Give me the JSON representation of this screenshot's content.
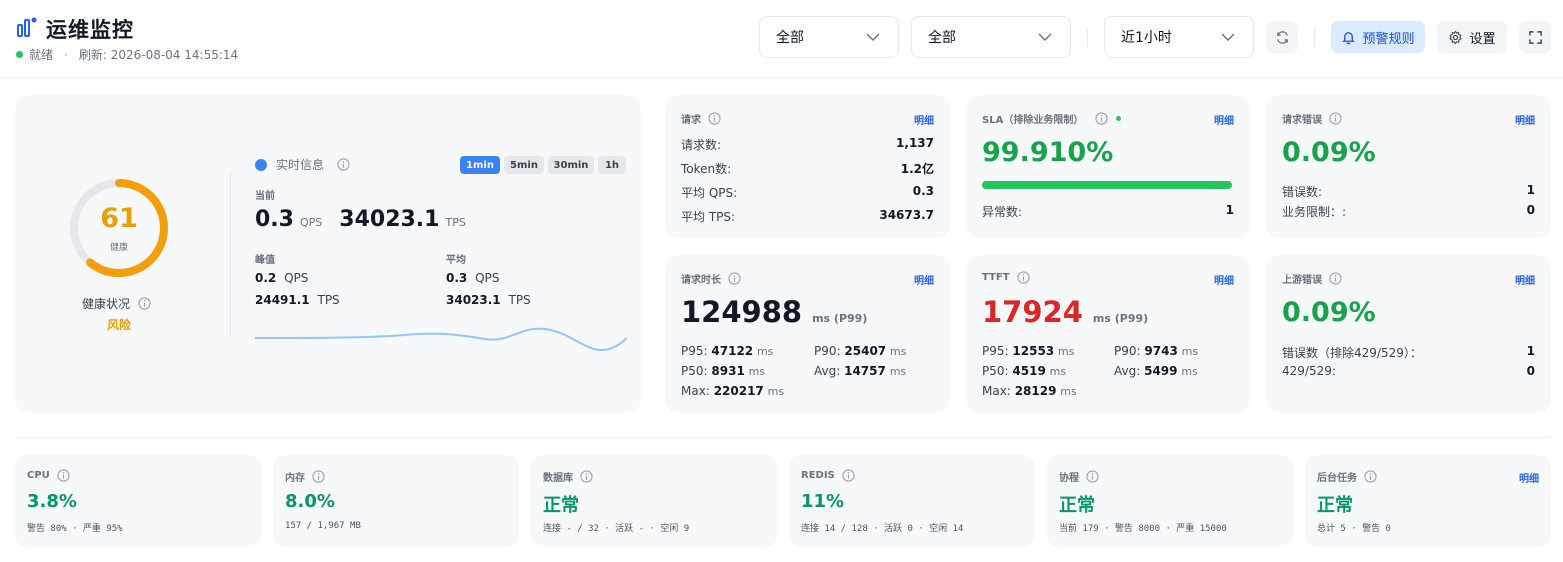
{
  "header": {
    "title": "运维监控",
    "status": "就绪",
    "sep": "·",
    "refresh": "刷新: 2026-08-04 14:55:14",
    "filter1": "全部",
    "filter2": "全部",
    "range": "近1小时",
    "alert_rules": "预警规则",
    "settings": "设置"
  },
  "colors": {
    "accent": "#3b82f6",
    "ok": "#16a34a",
    "danger": "#dc2626",
    "gauge": "#f59e0b"
  },
  "health": {
    "score": "61",
    "score_label": "健康",
    "title": "健康状况",
    "level": "风险",
    "score_fraction": 0.61
  },
  "realtime": {
    "title": "实时信息",
    "tabs": [
      "1min",
      "5min",
      "30min",
      "1h"
    ],
    "current_label": "当前",
    "current_qps": "0.3",
    "qps_unit": "QPS",
    "current_tps": "34023.1",
    "tps_unit": "TPS",
    "peak_label": "峰值",
    "peak_qps": "0.2",
    "peak_tps": "24491.1",
    "avg_label": "平均",
    "avg_qps": "0.3",
    "avg_tps": "34023.1"
  },
  "requests": {
    "label": "请求",
    "detail": "明细",
    "rows": [
      {
        "k": "请求数:",
        "v": "1,137"
      },
      {
        "k": "Token数:",
        "v": "1.2亿"
      },
      {
        "k": "平均 QPS:",
        "v": "0.3"
      },
      {
        "k": "平均 TPS:",
        "v": "34673.7"
      }
    ]
  },
  "sla": {
    "label": "SLA（排除业务限制）",
    "detail": "明细",
    "value": "99.910%",
    "progress": 0.9991,
    "abnormal_label": "异常数:",
    "abnormal": "1"
  },
  "req_errors": {
    "label": "请求错误",
    "detail": "明细",
    "value": "0.09%",
    "rows": [
      {
        "k": "错误数:",
        "v": "1"
      },
      {
        "k": "业务限制：:",
        "v": "0"
      }
    ]
  },
  "latency": {
    "label": "请求时长",
    "detail": "明细",
    "value": "124988",
    "unit": "ms (P99)",
    "p95_label": "P95:",
    "p95": "47122",
    "p90_label": "P90:",
    "p90": "25407",
    "p50_label": "P50:",
    "p50": "8931",
    "avg_label": "Avg:",
    "avg": "14757",
    "max_label": "Max:",
    "max": "220217",
    "ms": "ms"
  },
  "ttft": {
    "label": "TTFT",
    "detail": "明细",
    "value": "17924",
    "unit": "ms (P99)",
    "p95_label": "P95:",
    "p95": "12553",
    "p90_label": "P90:",
    "p90": "9743",
    "p50_label": "P50:",
    "p50": "4519",
    "avg_label": "Avg:",
    "avg": "5499",
    "max_label": "Max:",
    "max": "28129",
    "ms": "ms"
  },
  "upstream": {
    "label": "上游错误",
    "detail": "明细",
    "value": "0.09%",
    "rows": [
      {
        "k": "错误数（排除429/529）：",
        "v": "1"
      },
      {
        "k": "429/529:",
        "v": "0"
      }
    ]
  },
  "system": [
    {
      "label": "CPU",
      "value": "3.8%",
      "sub": "警告 80% · 严重 95%"
    },
    {
      "label": "内存",
      "value": "8.0%",
      "sub": "157 / 1,967 MB"
    },
    {
      "label": "数据库",
      "value": "正常",
      "sub": "连接 - / 32 · 活跃 - · 空闲 9"
    },
    {
      "label": "REDIS",
      "value": "11%",
      "sub": "连接 14 / 128 · 活跃 0 · 空闲 14"
    },
    {
      "label": "协程",
      "value": "正常",
      "sub": "当前 179 · 警告 8000 · 严重 15000"
    },
    {
      "label": "后台任务",
      "value": "正常",
      "sub": "总计 5 · 警告 0",
      "detail": "明细"
    }
  ]
}
